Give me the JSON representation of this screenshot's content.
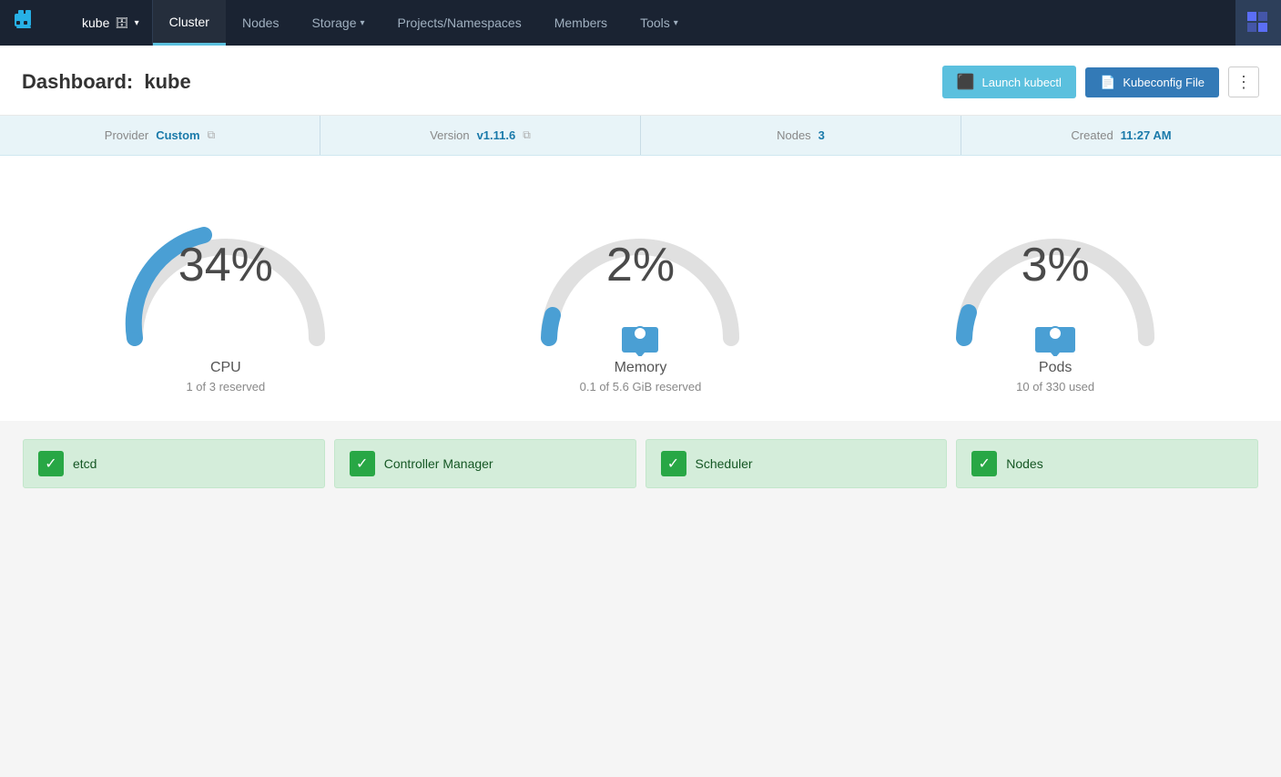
{
  "navbar": {
    "brand_alt": "Rancher",
    "kube_selector": "kube",
    "nav_items": [
      {
        "label": "Cluster",
        "active": true
      },
      {
        "label": "Nodes",
        "active": false
      },
      {
        "label": "Storage",
        "active": false,
        "has_dropdown": true
      },
      {
        "label": "Projects/Namespaces",
        "active": false
      },
      {
        "label": "Members",
        "active": false
      },
      {
        "label": "Tools",
        "active": false,
        "has_dropdown": true
      }
    ]
  },
  "page_header": {
    "title_prefix": "Dashboard:",
    "title_name": "kube",
    "btn_kubectl": "Launch kubectl",
    "btn_kubeconfig": "Kubeconfig File",
    "btn_more_icon": "⋮"
  },
  "info_bar": {
    "provider_label": "Provider",
    "provider_value": "Custom",
    "version_label": "Version",
    "version_value": "v1.11.6",
    "nodes_label": "Nodes",
    "nodes_value": "3",
    "created_label": "Created",
    "created_value": "11:27 AM"
  },
  "gauges": [
    {
      "id": "cpu",
      "percent": "34%",
      "label": "CPU",
      "sublabel": "1 of 3 reserved",
      "value": 34,
      "color": "#4a9fd4",
      "track_color": "#e0e0e0",
      "has_indicator_top": true,
      "has_indicator_bottom": false
    },
    {
      "id": "memory",
      "percent": "2%",
      "label": "Memory",
      "sublabel": "0.1 of 5.6 GiB reserved",
      "value": 2,
      "color": "#4a9fd4",
      "track_color": "#e0e0e0",
      "has_indicator_top": false,
      "has_indicator_bottom": true
    },
    {
      "id": "pods",
      "percent": "3%",
      "label": "Pods",
      "sublabel": "10 of 330 used",
      "value": 3,
      "color": "#4a9fd4",
      "track_color": "#e0e0e0",
      "has_indicator_top": false,
      "has_indicator_bottom": true
    }
  ],
  "status_items": [
    {
      "id": "etcd",
      "label": "etcd",
      "status": "ok"
    },
    {
      "id": "controller-manager",
      "label": "Controller Manager",
      "status": "ok"
    },
    {
      "id": "scheduler",
      "label": "Scheduler",
      "status": "ok"
    },
    {
      "id": "nodes",
      "label": "Nodes",
      "status": "ok"
    }
  ]
}
